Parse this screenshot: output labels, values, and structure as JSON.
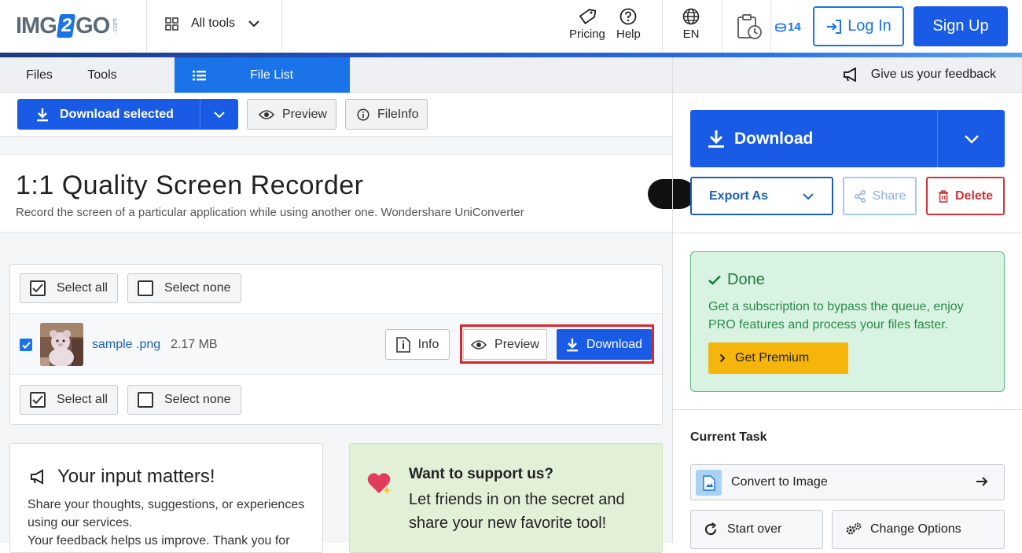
{
  "header": {
    "logo": {
      "pre": "IMG",
      "mid": "2",
      "post": "GO",
      "suffix": ".com"
    },
    "all_tools": "All tools",
    "pricing": "Pricing",
    "help": "Help",
    "language": "EN",
    "credits": "14",
    "login": "Log In",
    "signup": "Sign Up"
  },
  "tabs": {
    "files": "Files",
    "tools": "Tools",
    "file_list": "File List"
  },
  "toolbar": {
    "download_selected": "Download selected",
    "preview": "Preview",
    "fileinfo": "FileInfo"
  },
  "ad": {
    "title": "1:1 Quality Screen Recorder",
    "subtitle": "Record the screen of a particular application while using another one. Wondershare UniConverter"
  },
  "files": {
    "select_all": "Select all",
    "select_none": "Select none",
    "items": [
      {
        "name": "sample .png",
        "size": "2.17 MB",
        "checked": true,
        "info": "Info",
        "preview": "Preview",
        "download": "Download"
      }
    ]
  },
  "input_card": {
    "title": "Your input matters!",
    "text": "Share your thoughts, suggestions, or experiences using our services.",
    "text_cut": "Your feedback helps us improve. Thank you for"
  },
  "support_card": {
    "title": "Want to support us?",
    "text": "Let friends in on the secret and share your new favorite tool!"
  },
  "sidebar": {
    "feedback": "Give us your feedback",
    "download": "Download",
    "export_as": "Export As",
    "share": "Share",
    "delete": "Delete",
    "done_title": "Done",
    "done_text": "Get a subscription to bypass the queue, enjoy PRO features and process your files faster.",
    "get_premium": "Get Premium",
    "current_task": "Current Task",
    "convert_to_image": "Convert to Image",
    "start_over": "Start over",
    "change_options": "Change Options"
  },
  "colors": {
    "primary": "#1a5be6",
    "accent": "#1a73e8",
    "highlight": "#d7262d",
    "done_bg": "#d9f3e2",
    "premium": "#f5b50a",
    "support_bg": "#e3f0d8"
  }
}
